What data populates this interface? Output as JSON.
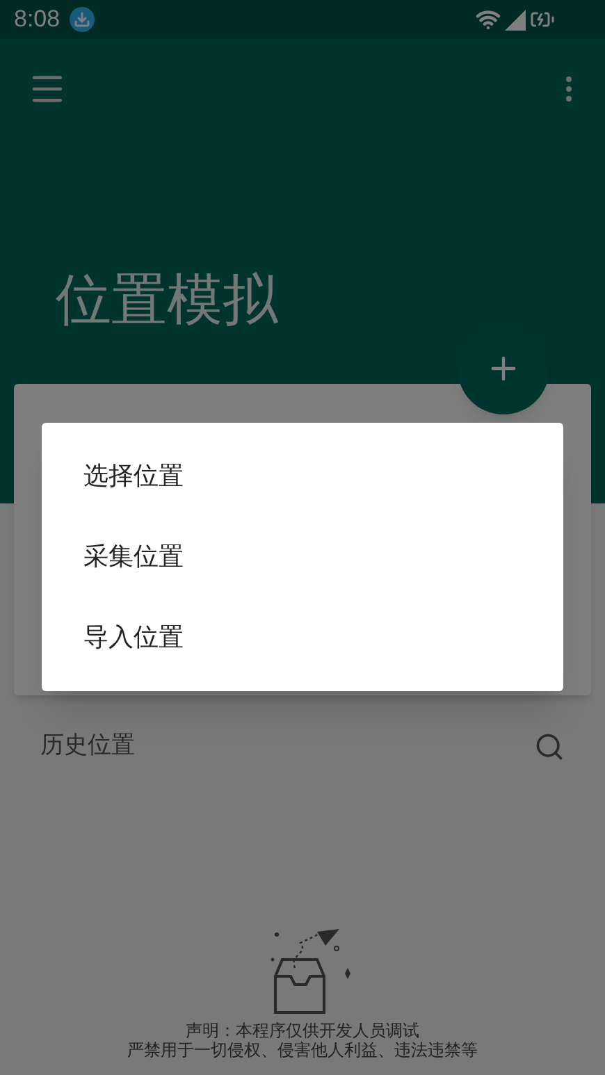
{
  "status_bar": {
    "time": "8:08"
  },
  "header": {
    "title": "位置模拟"
  },
  "history": {
    "title": "历史位置"
  },
  "disclaimer": [
    "声明：本程序仅供开发人员调试",
    "严禁用于一切侵权、侵害他人利益、违法违禁等"
  ],
  "dialog": {
    "items": [
      "选择位置",
      "采集位置",
      "导入位置"
    ]
  }
}
